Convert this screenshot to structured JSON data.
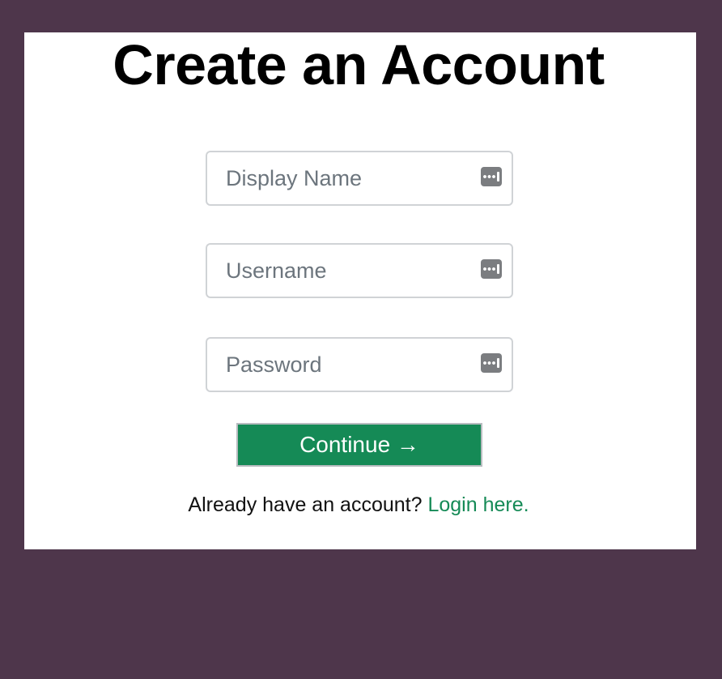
{
  "page": {
    "title": "Create an Account"
  },
  "form": {
    "display_name": {
      "placeholder": "Display Name",
      "value": ""
    },
    "username": {
      "placeholder": "Username",
      "value": ""
    },
    "password": {
      "placeholder": "Password",
      "value": ""
    },
    "continue_label": "Continue →"
  },
  "footer": {
    "prompt": "Already have an account? ",
    "login_link": "Login here."
  },
  "icons": {
    "field_icon": "password-manager-icon"
  },
  "colors": {
    "background": "#4e364b",
    "card": "#ffffff",
    "accent": "#158a56"
  }
}
